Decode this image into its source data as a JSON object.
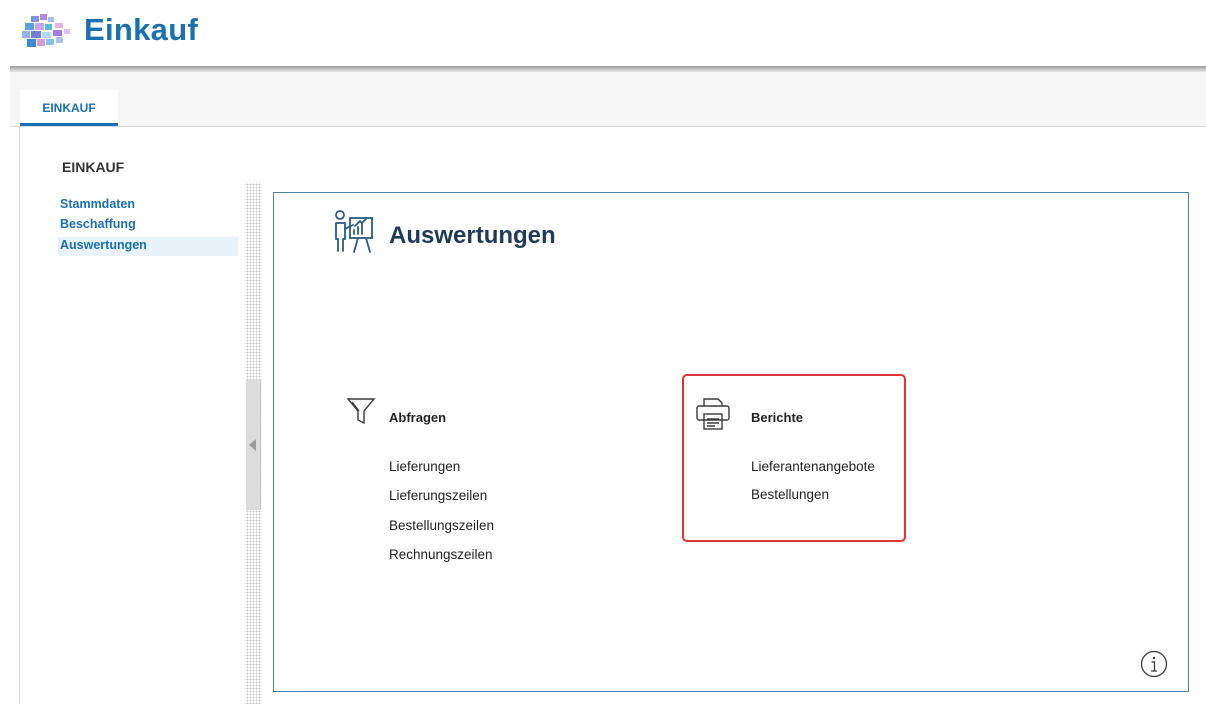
{
  "app": {
    "title": "Einkauf"
  },
  "tabs": [
    {
      "label": "EINKAUF",
      "active": true
    }
  ],
  "sidebar": {
    "title": "EINKAUF",
    "items": [
      {
        "label": "Stammdaten",
        "active": false
      },
      {
        "label": "Beschaffung",
        "active": false
      },
      {
        "label": "Auswertungen",
        "active": true
      }
    ]
  },
  "panel": {
    "title": "Auswertungen",
    "icon": "presentation-chart-icon",
    "groups": [
      {
        "title": "Abfragen",
        "icon": "funnel-icon",
        "links": [
          "Lieferungen",
          "Lieferungszeilen",
          "Bestellungszeilen",
          "Rechnungszeilen"
        ]
      },
      {
        "title": "Berichte",
        "icon": "printer-icon",
        "links": [
          "Lieferantenangebote",
          "Bestellungen"
        ],
        "highlighted": true
      }
    ]
  },
  "colors": {
    "accent": "#1b6fb3",
    "panel_border": "#4f7ea3",
    "highlight": "#e23434",
    "active_nav_bg": "#e8f2fa"
  }
}
